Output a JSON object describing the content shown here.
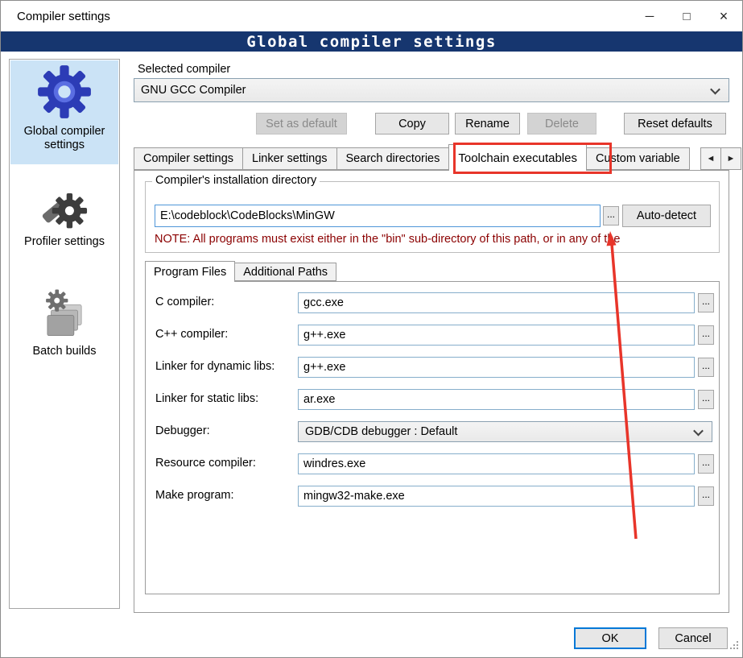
{
  "window": {
    "title": "Compiler settings",
    "banner": "Global compiler settings",
    "controls": {
      "minimize": "─",
      "maximize": "□",
      "close": "×"
    }
  },
  "sidebar": {
    "items": [
      {
        "label": "Global compiler settings",
        "selected": true
      },
      {
        "label": "Profiler settings",
        "selected": false
      },
      {
        "label": "Batch builds",
        "selected": false
      }
    ]
  },
  "compiler": {
    "label": "Selected compiler",
    "value": "GNU GCC Compiler",
    "buttons": {
      "set_default": "Set as default",
      "copy": "Copy",
      "rename": "Rename",
      "delete": "Delete",
      "reset": "Reset defaults"
    }
  },
  "tabs": {
    "items": [
      {
        "label": "Compiler settings",
        "selected": false
      },
      {
        "label": "Linker settings",
        "selected": false
      },
      {
        "label": "Search directories",
        "selected": false
      },
      {
        "label": "Toolchain executables",
        "selected": true
      },
      {
        "label": "Custom variable",
        "selected": false
      }
    ],
    "scroll_left": "◄",
    "scroll_right": "►"
  },
  "toolchain": {
    "group_title": "Compiler's installation directory",
    "install_dir": "E:\\codeblock\\CodeBlocks\\MinGW",
    "browse": "...",
    "autodetect": "Auto-detect",
    "note": "NOTE: All programs must exist either in the \"bin\" sub-directory of this path, or in any of the",
    "inner_tabs": [
      {
        "label": "Program Files",
        "selected": true
      },
      {
        "label": "Additional Paths",
        "selected": false
      }
    ],
    "fields": [
      {
        "label": "C compiler:",
        "value": "gcc.exe"
      },
      {
        "label": "C++ compiler:",
        "value": "g++.exe"
      },
      {
        "label": "Linker for dynamic libs:",
        "value": "g++.exe"
      },
      {
        "label": "Linker for static libs:",
        "value": "ar.exe"
      },
      {
        "label": "Debugger:",
        "value": "GDB/CDB debugger : Default"
      },
      {
        "label": "Resource compiler:",
        "value": "windres.exe"
      },
      {
        "label": "Make program:",
        "value": "mingw32-make.exe"
      }
    ]
  },
  "footer": {
    "ok": "OK",
    "cancel": "Cancel"
  },
  "colors": {
    "banner_bg": "#16366f",
    "note_red": "#8b0000",
    "annotation_red": "#e8352a",
    "focus_blue": "#0078d7",
    "sidebar_selected": "#cbe3f6"
  }
}
